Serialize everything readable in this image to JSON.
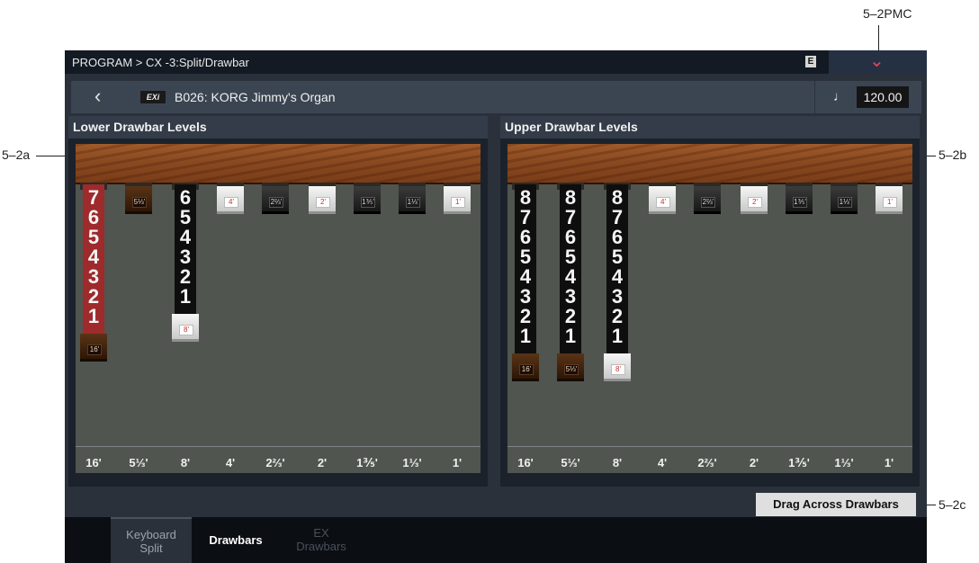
{
  "callouts": {
    "top": "5–2PMC",
    "left": "5–2a",
    "right": "5–2b",
    "bottom": "5–2c"
  },
  "header": {
    "breadcrumb": "PROGRAM > CX -3:Split/Drawbar",
    "badge": "E",
    "menu_icon": "chevron-down-icon"
  },
  "program": {
    "back_icon": "chevron-left-icon",
    "type_badge": "EXi",
    "name": "B026: KORG Jimmy's Organ",
    "tempo_icon": "quarter-note-icon",
    "tempo": "120.00"
  },
  "footages": [
    "16'",
    "5⅓'",
    "8'",
    "4'",
    "2⅔'",
    "2'",
    "1⅗'",
    "1⅓'",
    "1'"
  ],
  "knob_labels": [
    "16'",
    "5⅓'",
    "8'",
    "4'",
    "2⅔'",
    "2'",
    "1⅗'",
    "1⅓'",
    "1'"
  ],
  "lower": {
    "title": "Lower Drawbar Levels",
    "levels": [
      7,
      0,
      6,
      0,
      0,
      0,
      0,
      0,
      0
    ]
  },
  "upper": {
    "title": "Upper Drawbar Levels",
    "levels": [
      8,
      8,
      8,
      0,
      0,
      0,
      0,
      0,
      0
    ]
  },
  "drag_button": "Drag Across Drawbars",
  "tabs": [
    {
      "line1": "Keyboard",
      "line2": "Split",
      "state": "inactive"
    },
    {
      "line1": "Drawbars",
      "line2": "",
      "state": "active"
    },
    {
      "line1": "EX",
      "line2": "Drawbars",
      "state": "disabled"
    }
  ],
  "colors": {
    "accent": "#e6445c",
    "red_drawbar": "#9e2a2c",
    "panel_bg": "#1b222c"
  }
}
